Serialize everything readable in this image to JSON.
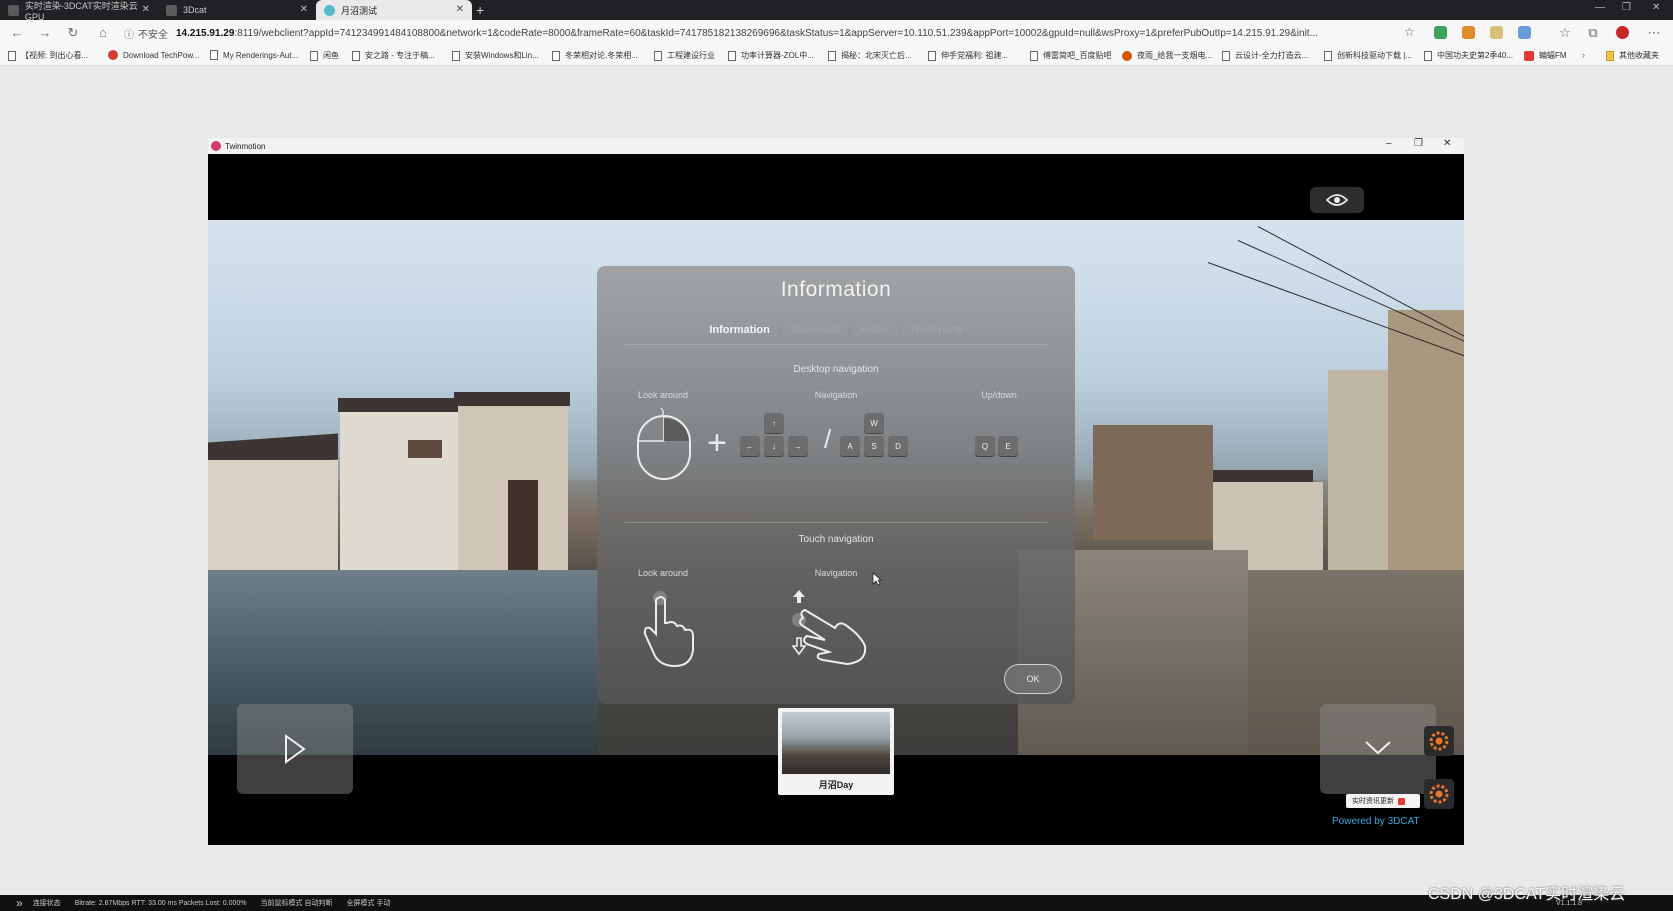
{
  "browser": {
    "tabs": [
      {
        "title": "实时渲染-3DCAT实时渲染云 GPU",
        "active": false
      },
      {
        "title": "3Dcat",
        "active": false
      },
      {
        "title": "月沼测试",
        "active": true
      }
    ],
    "new_tab": "+",
    "security": "不安全",
    "url_host": "14.215.91.29",
    "url_rest": ":8119/webclient?appId=741234991484108800&network=1&codeRate=8000&frameRate=60&taskId=741785182138269696&taskStatus=1&appServer=10.110.51.239&appPort=10002&gpuId=null&wsProxy=1&preferPubOutIp=14.215.91.29&init...",
    "bookmarks": [
      "【视频: 到出心看...",
      "Download TechPow...",
      "My Renderings-Aut...",
      "闲鱼",
      "安之路 - 专注于稿...",
      "安装Windows和Lin...",
      "冬荣相对论,冬荣相...",
      "工程建设行业",
      "功率计算器-ZOL中...",
      "揭秘：北宋灭亡后...",
      "伸手党福利: 祖建...",
      "傅雷简吧_百度贴吧",
      "夜雨_给我一支烟电...",
      "云设计-全力打造云...",
      "创新科技驱动下载 |...",
      "中国功夫史第2季40...",
      "蝙蝠FM",
      "其他收藏夹"
    ]
  },
  "app": {
    "window_title": "Twinmotion",
    "dialog": {
      "title": "Information",
      "tabs": [
        "Information",
        "Gamepad",
        "EULA",
        "Third-party"
      ],
      "desktop_section": "Desktop navigation",
      "desktop_cols": [
        "Look around",
        "Navigation",
        "Up/down"
      ],
      "arrow_keys": {
        "up": "↑",
        "left": "←",
        "down": "↓",
        "right": "→"
      },
      "wasd_keys": {
        "w": "W",
        "a": "A",
        "s": "S",
        "d": "D"
      },
      "updown_keys": {
        "q": "Q",
        "e": "E"
      },
      "plus": "+",
      "slash": "/",
      "touch_section": "Touch navigation",
      "touch_cols": [
        "Look around",
        "Navigation"
      ],
      "ok_label": "OK"
    },
    "thumbnail_label": "月沼Day",
    "news_chip": "实时资讯更新",
    "powered_by": "Powered by 3DCAT"
  },
  "statusbar": {
    "items": [
      "连接状态",
      "Bitrate: 2.87Mbps RTT: 33.00 ms Packets Lost: 0.000%",
      "当前鼠标模式 自动判断",
      "全屏模式 手动"
    ],
    "version": "V1.1.1.8"
  },
  "watermark": "CSDN @3DCAT实时渲染云",
  "icons": [
    "eye-icon",
    "play-icon",
    "chevron-down-icon",
    "mouse-icon",
    "touch-hand-icon",
    "settings-gear-icon"
  ]
}
